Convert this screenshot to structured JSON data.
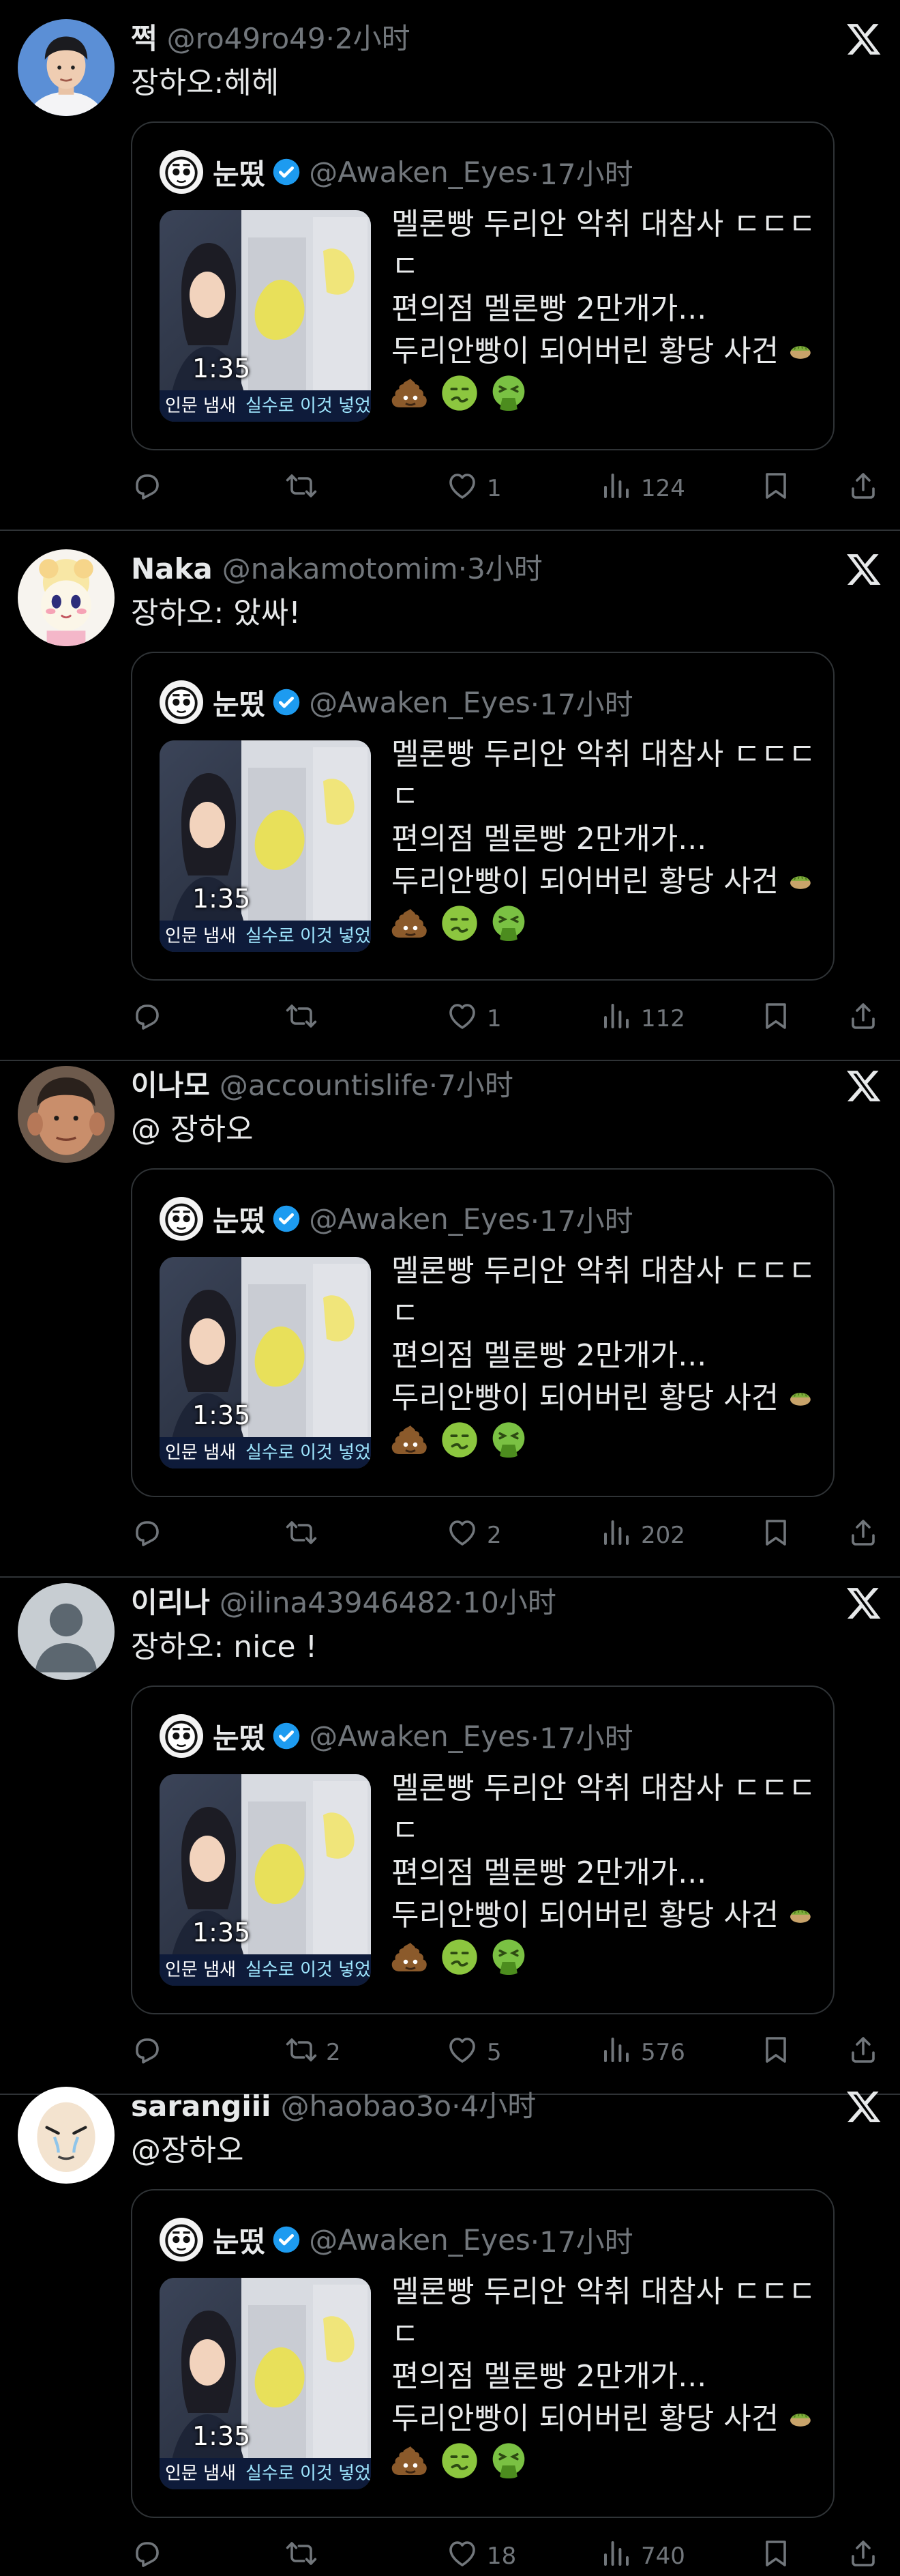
{
  "quoted": {
    "name": "눈떴",
    "handle": "@Awaken_Eyes",
    "time": "·17小时",
    "duration": "1:35",
    "caption_a": "인문 냄새",
    "caption_b": "실수로 이것 넣었",
    "lines": [
      "멜론빵 두리안 악취 대참사 ㄷㄷㄷㄷ",
      "ㄷ",
      "편의점 멜론빵 2만개가...",
      "두리안빵이 되어버린 황당 사건"
    ]
  },
  "tweets": [
    {
      "name": "쩍",
      "handle": "@ro49ro49",
      "time": "·2小时",
      "text": "장하오:헤헤",
      "reply_count": "",
      "retweet_count": "",
      "like_count": "",
      "view_count": "124"
    },
    {
      "name": "Naka",
      "handle": "@nakamotomim",
      "time": "·3小时",
      "text": "장하오: 았싸!",
      "reply_count": "",
      "retweet_count": "",
      "like_count": "1",
      "view_count": "112"
    },
    {
      "name": "이나모",
      "handle": "@accountislife",
      "time": "·7小时",
      "text": "@ 장하오",
      "reply_count": "",
      "retweet_count": "",
      "like_count": "2",
      "view_count": "202"
    },
    {
      "name": "이리나",
      "handle": "@ilina43946482",
      "time": "·10小时",
      "text": "장하오: nice !",
      "reply_count": "",
      "retweet_count": "2",
      "like_count": "5",
      "view_count": "576"
    },
    {
      "name": "sarangiii",
      "handle": "@haobao3o",
      "time": "·4小时",
      "text": "@장하오",
      "reply_count": "",
      "retweet_count": "",
      "like_count": "18",
      "view_count": "740"
    }
  ],
  "first_like_count": "1",
  "icons": {
    "platform": "x-logo-icon",
    "verified": "verified-badge-icon",
    "reply": "reply-icon",
    "retweet": "retweet-icon",
    "like": "like-icon",
    "views": "views-icon",
    "bookmark": "bookmark-icon",
    "share": "share-icon"
  },
  "colors": {
    "background": "#000000",
    "text": "#e7e9ea",
    "muted": "#71767b",
    "border": "#2f3336",
    "verified": "#1d9bf0"
  }
}
